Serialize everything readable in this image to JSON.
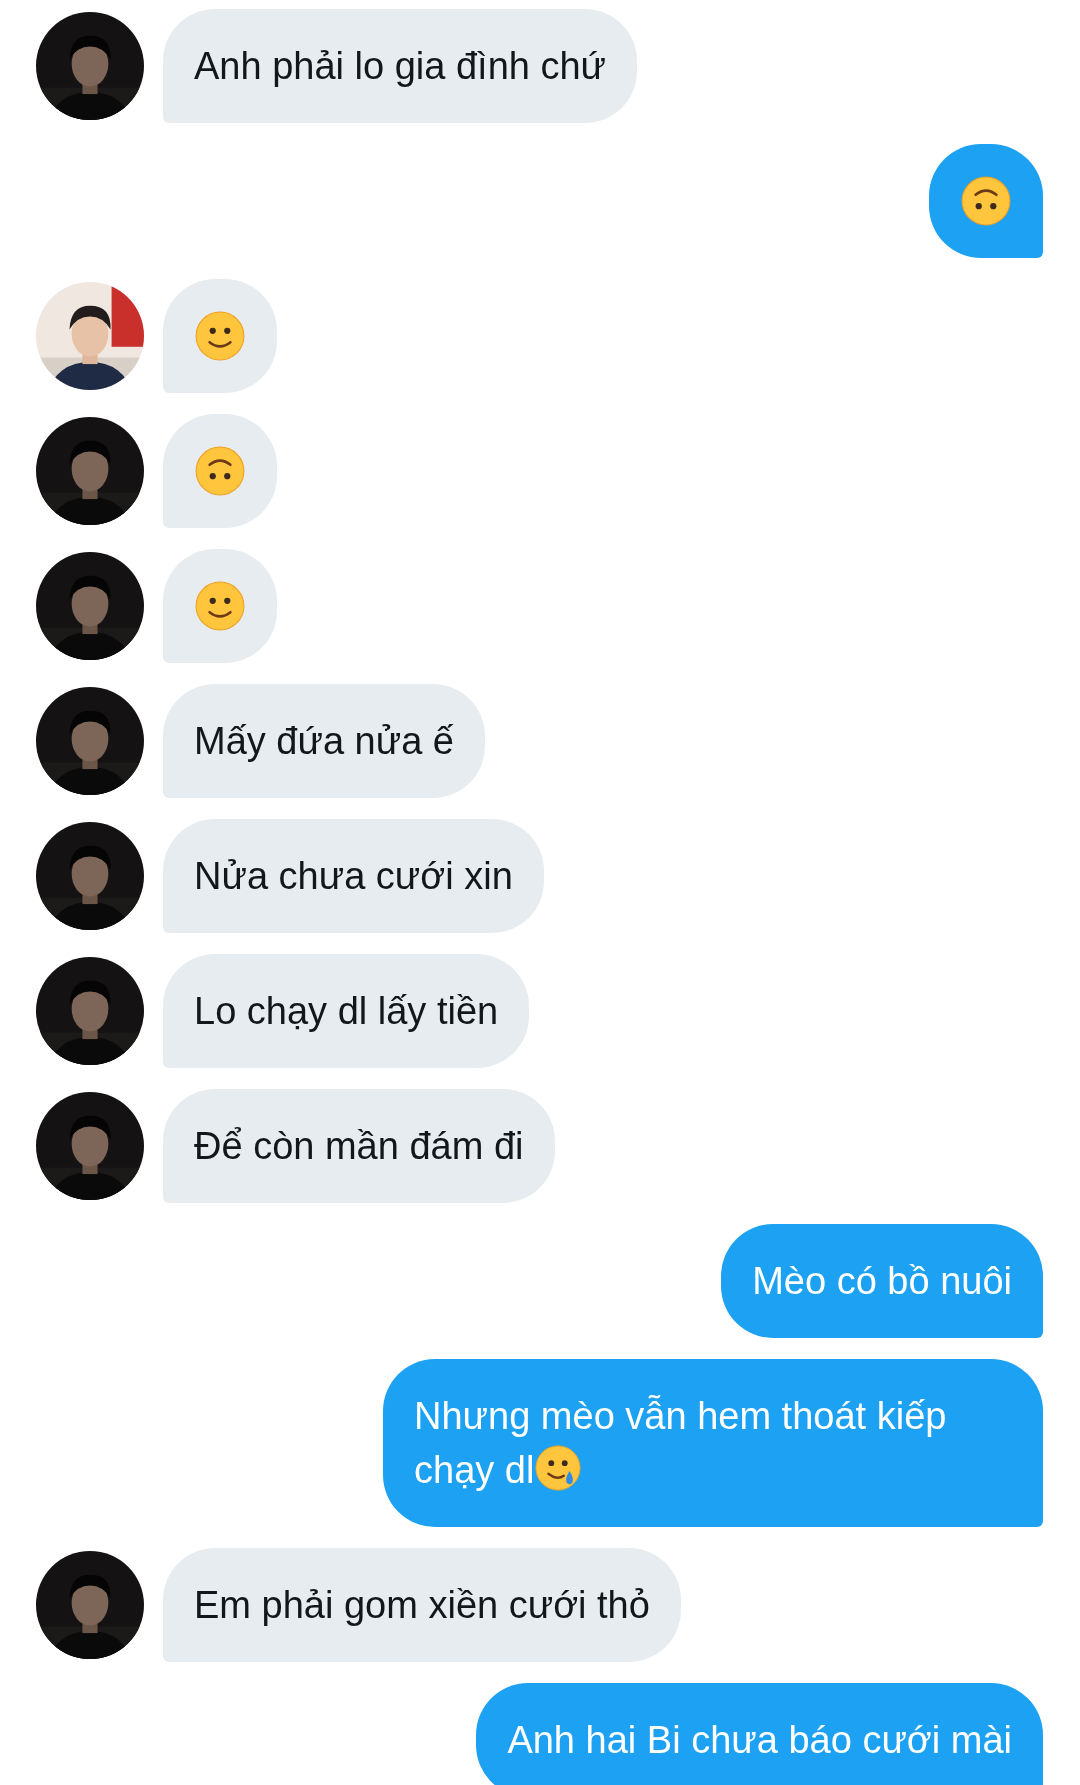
{
  "messages": [
    {
      "sent": false,
      "kind": "text",
      "text": "Anh phải lo gia đình chứ"
    },
    {
      "sent": true,
      "kind": "upside_down"
    },
    {
      "sent": false,
      "kind": "smile"
    },
    {
      "sent": false,
      "kind": "upside_down"
    },
    {
      "sent": false,
      "kind": "smile"
    },
    {
      "sent": false,
      "kind": "text",
      "text": "Mấy đứa nửa ế"
    },
    {
      "sent": false,
      "kind": "text",
      "text": "Nửa chưa cưới xin"
    },
    {
      "sent": false,
      "kind": "text",
      "text": "Lo chạy dl lấy tiền"
    },
    {
      "sent": false,
      "kind": "text",
      "text": "Để còn mần đám đi"
    },
    {
      "sent": true,
      "kind": "text",
      "text": "Mèo có bồ nuôi"
    },
    {
      "sent": true,
      "kind": "text",
      "text": "Nhưng mèo vẫn hem thoát kiếp chạy dl",
      "tear_emoji": true
    },
    {
      "sent": false,
      "kind": "text",
      "text": "Em phải gom xiền cưới thỏ"
    },
    {
      "sent": true,
      "kind": "text",
      "text": "Anh hai Bi chưa báo cưới mài"
    }
  ]
}
